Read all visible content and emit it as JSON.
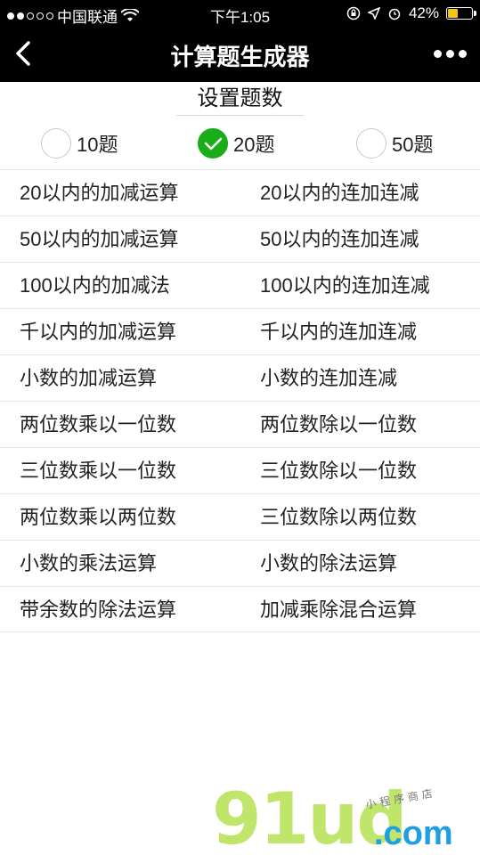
{
  "status_bar": {
    "carrier": "中国联通",
    "time": "下午1:05",
    "battery_percent": "42%",
    "signal_strength": 2
  },
  "navbar": {
    "title": "计算题生成器"
  },
  "settings": {
    "title": "设置题数",
    "options": [
      {
        "label": "10题",
        "checked": false
      },
      {
        "label": "20题",
        "checked": true
      },
      {
        "label": "50题",
        "checked": false
      }
    ]
  },
  "list": {
    "rows": [
      {
        "left": "20以内的加减运算",
        "right": "20以内的连加连减"
      },
      {
        "left": "50以内的加减运算",
        "right": "50以内的连加连减"
      },
      {
        "left": "100以内的加减法",
        "right": "100以内的连加连减"
      },
      {
        "left": "千以内的加减运算",
        "right": "千以内的连加连减"
      },
      {
        "left": "小数的加减运算",
        "right": "小数的连加连减"
      },
      {
        "left": "两位数乘以一位数",
        "right": "两位数除以一位数"
      },
      {
        "left": "三位数乘以一位数",
        "right": "三位数除以一位数"
      },
      {
        "left": "两位数乘以两位数",
        "right": "三位数除以两位数"
      },
      {
        "left": "小数的乘法运算",
        "right": "小数的除法运算"
      },
      {
        "left": "带余数的除法运算",
        "right": "加减乘除混合运算"
      }
    ]
  },
  "watermark": {
    "main": "91ud",
    "domain": ".com",
    "sub": "小程序商店"
  },
  "colors": {
    "header_bg": "#000000",
    "check_green": "#1aad19",
    "battery_yellow": "#f3c51a"
  }
}
